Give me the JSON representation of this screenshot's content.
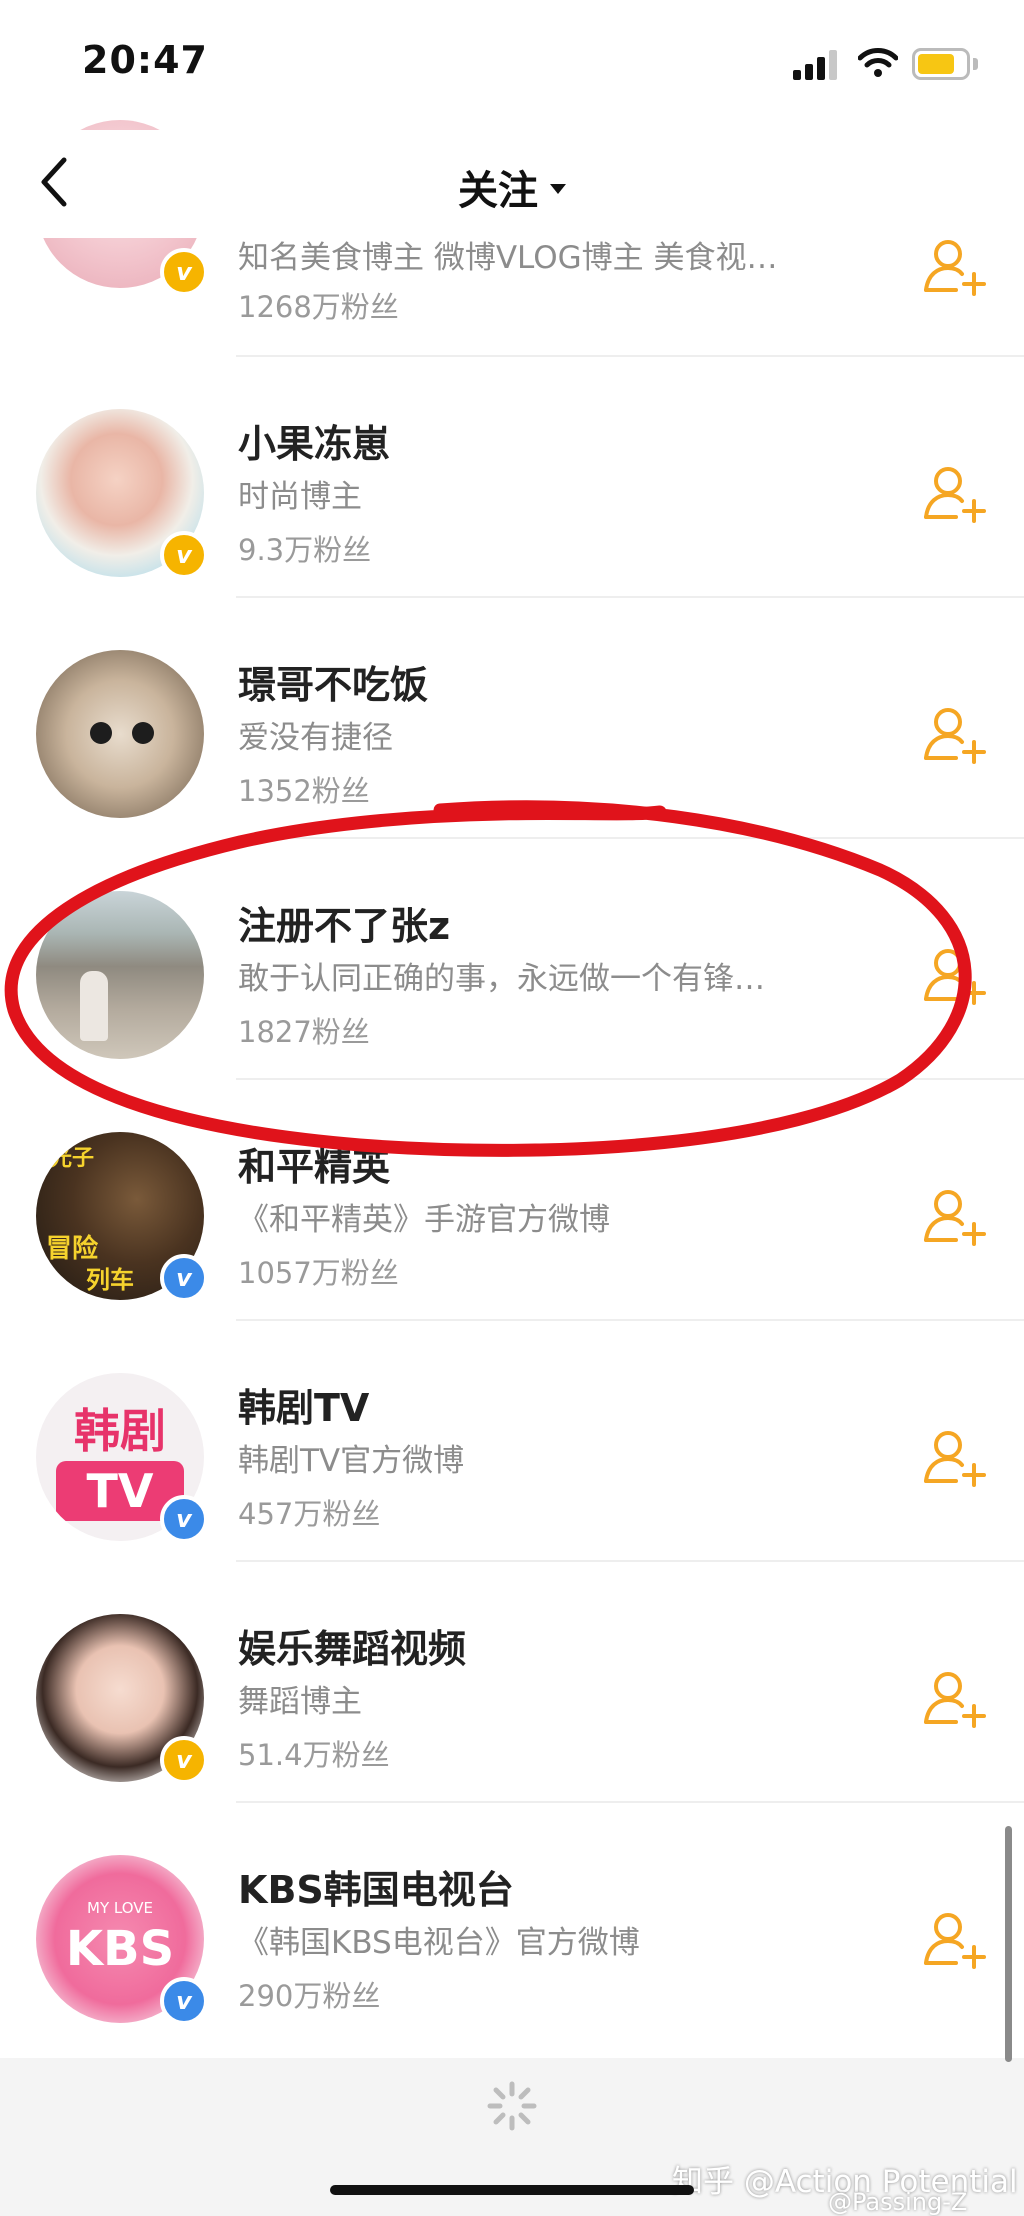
{
  "status_bar": {
    "time": "20:47"
  },
  "nav": {
    "title": "关注"
  },
  "users": [
    {
      "name": "",
      "bio": "知名美食博主 微博VLOG博主 美食视…",
      "fans": "1268万粉丝",
      "badge": "gold"
    },
    {
      "name": "小果冻崽",
      "bio": "时尚博主",
      "fans": "9.3万粉丝",
      "badge": "gold"
    },
    {
      "name": "璟哥不吃饭",
      "bio": "爱没有捷径",
      "fans": "1352粉丝",
      "badge": ""
    },
    {
      "name": "注册不了张z",
      "bio": "敢于认同正确的事，永远做一个有锋…",
      "fans": "1827粉丝",
      "badge": ""
    },
    {
      "name": "和平精英",
      "bio": "《和平精英》手游官方微博",
      "fans": "1057万粉丝",
      "badge": "blue"
    },
    {
      "name": "韩剧TV",
      "bio": "韩剧TV官方微博",
      "fans": "457万粉丝",
      "badge": "blue"
    },
    {
      "name": "娱乐舞蹈视频",
      "bio": "舞蹈博主",
      "fans": "51.4万粉丝",
      "badge": "gold"
    },
    {
      "name": "KBS韩国电视台",
      "bio": "《韩国KBS电视台》官方微博",
      "fans": "290万粉丝",
      "badge": "blue"
    }
  ],
  "avatar_text": {
    "hjy_top": "光子",
    "hjy_left": "冒险",
    "hjy_bottom": "列车",
    "hanju_line1": "韩剧",
    "hanju_line2": "TV",
    "kbs_small": "MY LOVE",
    "kbs_big": "KBS"
  },
  "watermark": {
    "line1": "知乎 @Action Potential",
    "line2": "@Passing-Z"
  },
  "colors": {
    "accent_orange": "#f5a623",
    "vip_gold": "#f6b400",
    "vip_blue": "#3b8ae8",
    "annotation_red": "#e0131b"
  }
}
